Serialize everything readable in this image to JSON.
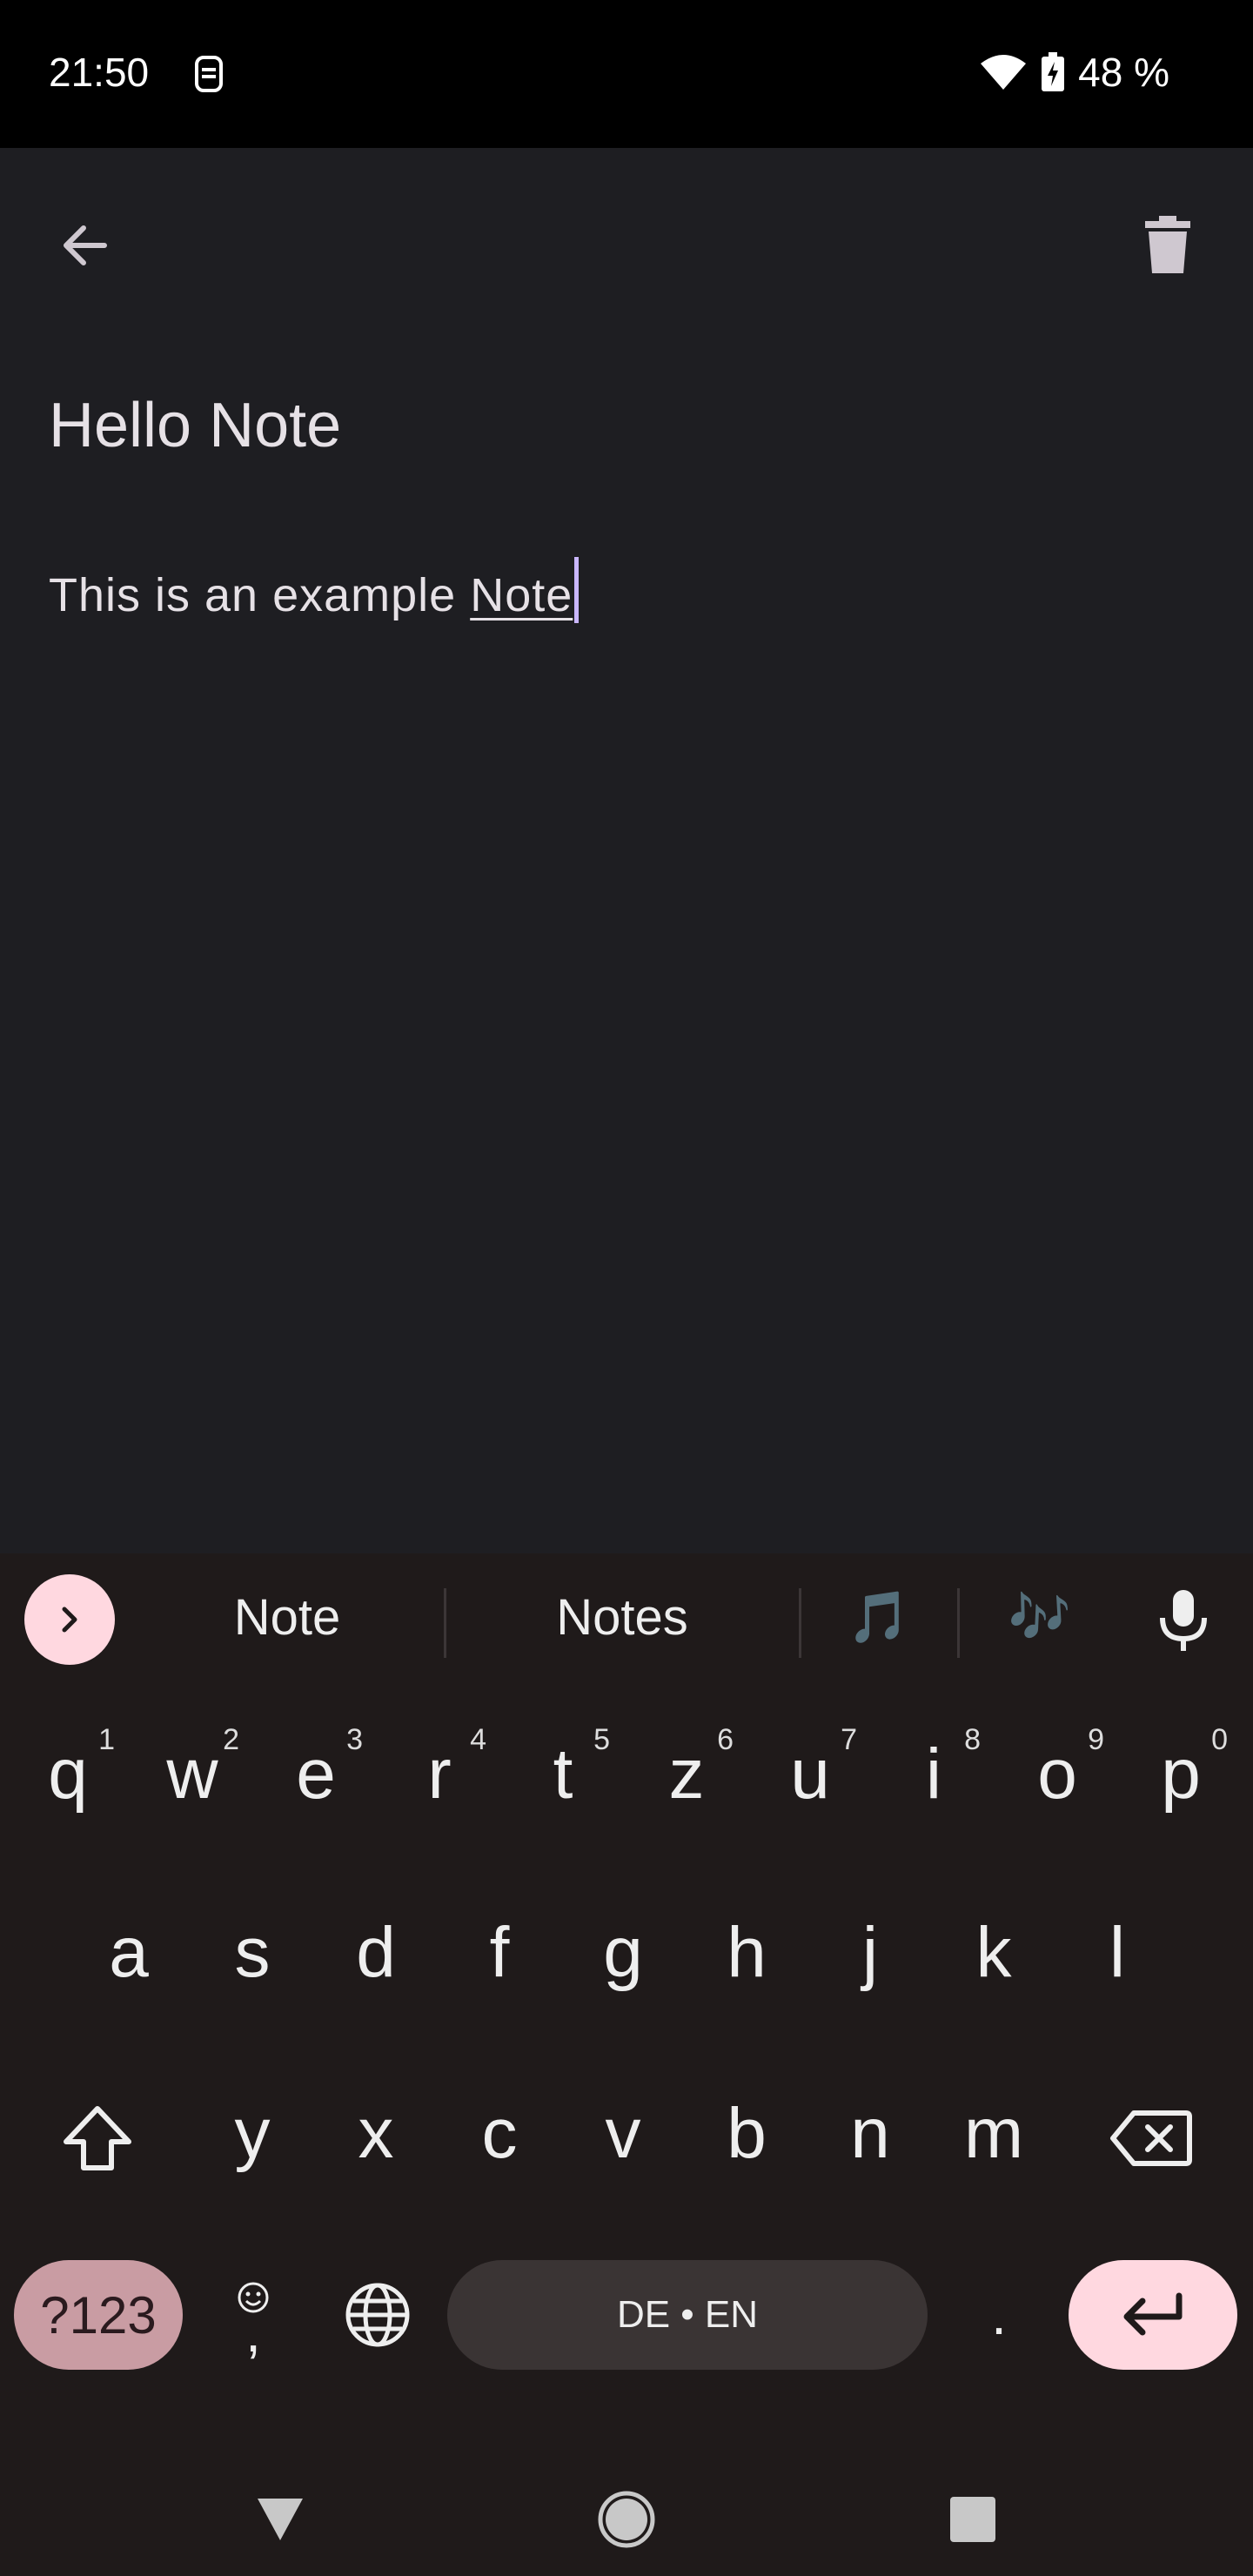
{
  "status_bar": {
    "time": "21:50",
    "battery_text": "48 %",
    "icons": [
      "sim-icon",
      "wifi-icon",
      "battery-charging-icon"
    ]
  },
  "toolbar": {
    "back_icon": "arrow-back-icon",
    "delete_icon": "trash-icon"
  },
  "note": {
    "title": "Hello Note",
    "body_prefix": "This is an example ",
    "body_underlined": "Note"
  },
  "keyboard": {
    "suggestions": [
      "Note",
      "Notes"
    ],
    "emoji_suggestions": [
      "🎵",
      "🎶"
    ],
    "row1": [
      {
        "k": "q",
        "h": "1"
      },
      {
        "k": "w",
        "h": "2"
      },
      {
        "k": "e",
        "h": "3"
      },
      {
        "k": "r",
        "h": "4"
      },
      {
        "k": "t",
        "h": "5"
      },
      {
        "k": "z",
        "h": "6"
      },
      {
        "k": "u",
        "h": "7"
      },
      {
        "k": "i",
        "h": "8"
      },
      {
        "k": "o",
        "h": "9"
      },
      {
        "k": "p",
        "h": "0"
      }
    ],
    "row2": [
      "a",
      "s",
      "d",
      "f",
      "g",
      "h",
      "j",
      "k",
      "l"
    ],
    "row3": [
      "y",
      "x",
      "c",
      "v",
      "b",
      "n",
      "m"
    ],
    "symbols_label": "?123",
    "comma": ",",
    "space_label": "DE • EN",
    "period": ".",
    "colors": {
      "accent_pink": "#ffd8e0",
      "symbols_key": "#c99ca3",
      "space_key": "#3a3434",
      "keyboard_bg": "#1f1a1a"
    }
  },
  "nav": {
    "icons": [
      "back-triangle-icon",
      "home-circle-icon",
      "recents-square-icon"
    ]
  }
}
